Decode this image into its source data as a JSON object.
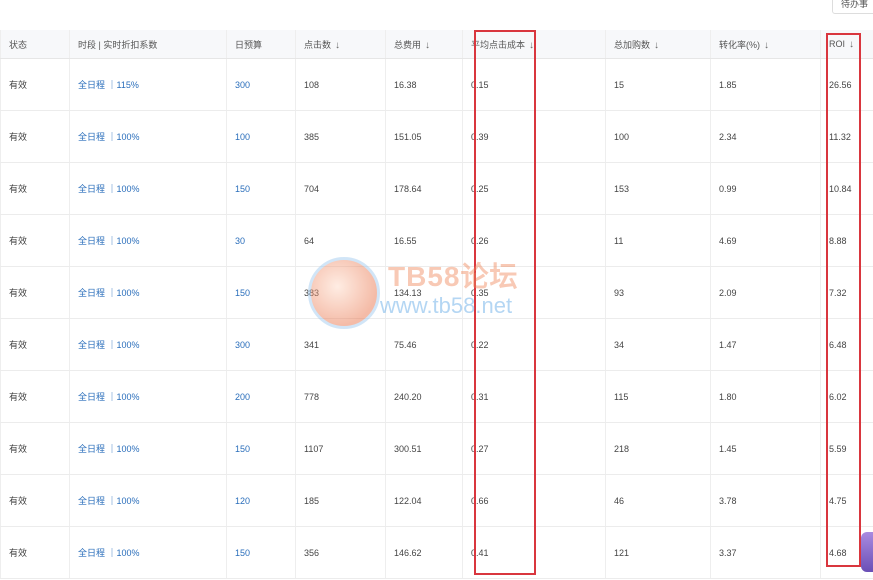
{
  "toolbar": {
    "todo_label": "待办事"
  },
  "columns": [
    {
      "label": "状态",
      "sortable": false
    },
    {
      "label": "时段 | 实时折扣系数",
      "sortable": false
    },
    {
      "label": "日预算",
      "sortable": false
    },
    {
      "label": "点击数",
      "sortable": true
    },
    {
      "label": "总费用",
      "sortable": true
    },
    {
      "label": "平均点击成本",
      "sortable": true
    },
    {
      "label": "总加购数",
      "sortable": true
    },
    {
      "label": "转化率(%)",
      "sortable": true
    },
    {
      "label": "ROI",
      "sortable": true
    }
  ],
  "sort_icon": "arrow-down-icon",
  "rows": [
    {
      "status": "有效",
      "schedule": "全日程 ｜115%",
      "budget": "300",
      "clicks": "108",
      "cost": "16.38",
      "cpc": "0.15",
      "carts": "15",
      "cvr": "1.85",
      "roi": "26.56"
    },
    {
      "status": "有效",
      "schedule": "全日程 ｜100%",
      "budget": "100",
      "clicks": "385",
      "cost": "151.05",
      "cpc": "0.39",
      "carts": "100",
      "cvr": "2.34",
      "roi": "11.32"
    },
    {
      "status": "有效",
      "schedule": "全日程 ｜100%",
      "budget": "150",
      "clicks": "704",
      "cost": "178.64",
      "cpc": "0.25",
      "carts": "153",
      "cvr": "0.99",
      "roi": "10.84"
    },
    {
      "status": "有效",
      "schedule": "全日程 ｜100%",
      "budget": "30",
      "clicks": "64",
      "cost": "16.55",
      "cpc": "0.26",
      "carts": "11",
      "cvr": "4.69",
      "roi": "8.88"
    },
    {
      "status": "有效",
      "schedule": "全日程 ｜100%",
      "budget": "150",
      "clicks": "383",
      "cost": "134.13",
      "cpc": "0.35",
      "carts": "93",
      "cvr": "2.09",
      "roi": "7.32"
    },
    {
      "status": "有效",
      "schedule": "全日程 ｜100%",
      "budget": "300",
      "clicks": "341",
      "cost": "75.46",
      "cpc": "0.22",
      "carts": "34",
      "cvr": "1.47",
      "roi": "6.48"
    },
    {
      "status": "有效",
      "schedule": "全日程 ｜100%",
      "budget": "200",
      "clicks": "778",
      "cost": "240.20",
      "cpc": "0.31",
      "carts": "115",
      "cvr": "1.80",
      "roi": "6.02"
    },
    {
      "status": "有效",
      "schedule": "全日程 ｜100%",
      "budget": "150",
      "clicks": "1107",
      "cost": "300.51",
      "cpc": "0.27",
      "carts": "218",
      "cvr": "1.45",
      "roi": "5.59"
    },
    {
      "status": "有效",
      "schedule": "全日程 ｜100%",
      "budget": "120",
      "clicks": "185",
      "cost": "122.04",
      "cpc": "0.66",
      "carts": "46",
      "cvr": "3.78",
      "roi": "4.75"
    },
    {
      "status": "有效",
      "schedule": "全日程 ｜100%",
      "budget": "150",
      "clicks": "356",
      "cost": "146.62",
      "cpc": "0.41",
      "carts": "121",
      "cvr": "3.37",
      "roi": "4.68"
    }
  ],
  "watermark": {
    "title": "TB58论坛",
    "url": "www.tb58.net"
  },
  "highlight_color": "#d9363e",
  "link_color": "#2a6ebb"
}
